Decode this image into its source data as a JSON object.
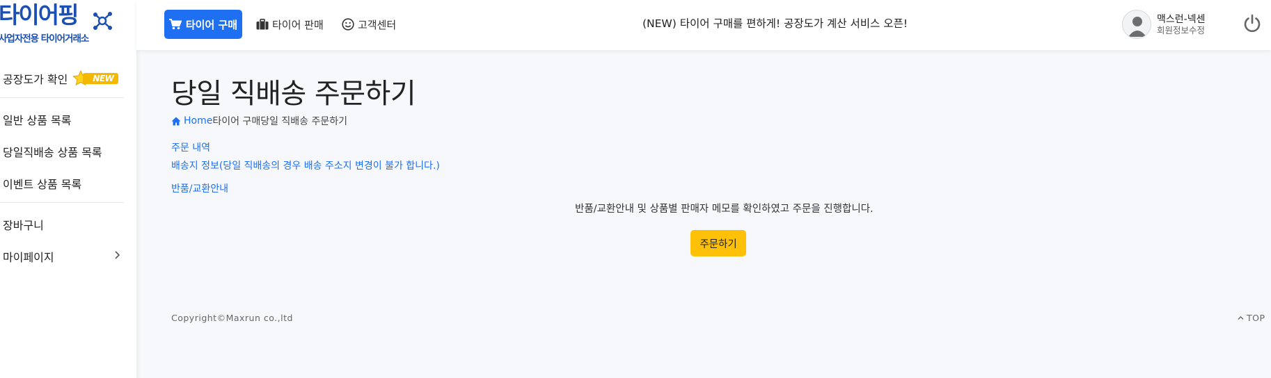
{
  "logo": {
    "main": "타이어핑",
    "sub": "사업자전용 타이어거래소"
  },
  "sidebar": {
    "items": [
      {
        "label": "공장도가 확인",
        "badge": "NEW"
      },
      {
        "label": "일반 상품 목록"
      },
      {
        "label": "당일직배송 상품 목록"
      },
      {
        "label": "이벤트 상품 목록"
      },
      {
        "label": "장바구니"
      },
      {
        "label": "마이페이지"
      }
    ]
  },
  "topbar": {
    "buy_label": "타이어 구매",
    "sell_label": "타이어 판매",
    "cs_label": "고객센터",
    "notice": "(NEW) 타이어 구매를 편하게! 공장도가 계산 서비스 오픈!",
    "user_name": "맥스런-넥센",
    "user_edit": "회원정보수정"
  },
  "main": {
    "title": "당일 직배송 주문하기",
    "breadcrumb": {
      "home": "Home",
      "parent": "타이어 구매",
      "current": "당일 직배송 주문하기"
    },
    "links": {
      "order_history": "주문 내역",
      "shipping_info": "배송지 정보(당일 직배송의 경우 배송 주소지 변경이 불가 합니다.)",
      "return_info": "반품/교환안내"
    },
    "confirm_text": "반품/교환안내 및 상품별 판매자 메모를 확인하였고 주문을 진행합니다.",
    "order_button": "주문하기"
  },
  "footer": {
    "copyright": "Copyright©Maxrun co.,ltd",
    "top": "TOP"
  },
  "colors": {
    "primary": "#1e6ff1",
    "brand": "#1a4fb4",
    "order_button": "#ffc107",
    "badge": "#f5b800"
  },
  "icons": {
    "buy": "cart-icon",
    "sell": "briefcase-icon",
    "cs": "smile-icon",
    "home": "home-icon",
    "power": "power-icon",
    "top": "chevron-up-icon"
  }
}
